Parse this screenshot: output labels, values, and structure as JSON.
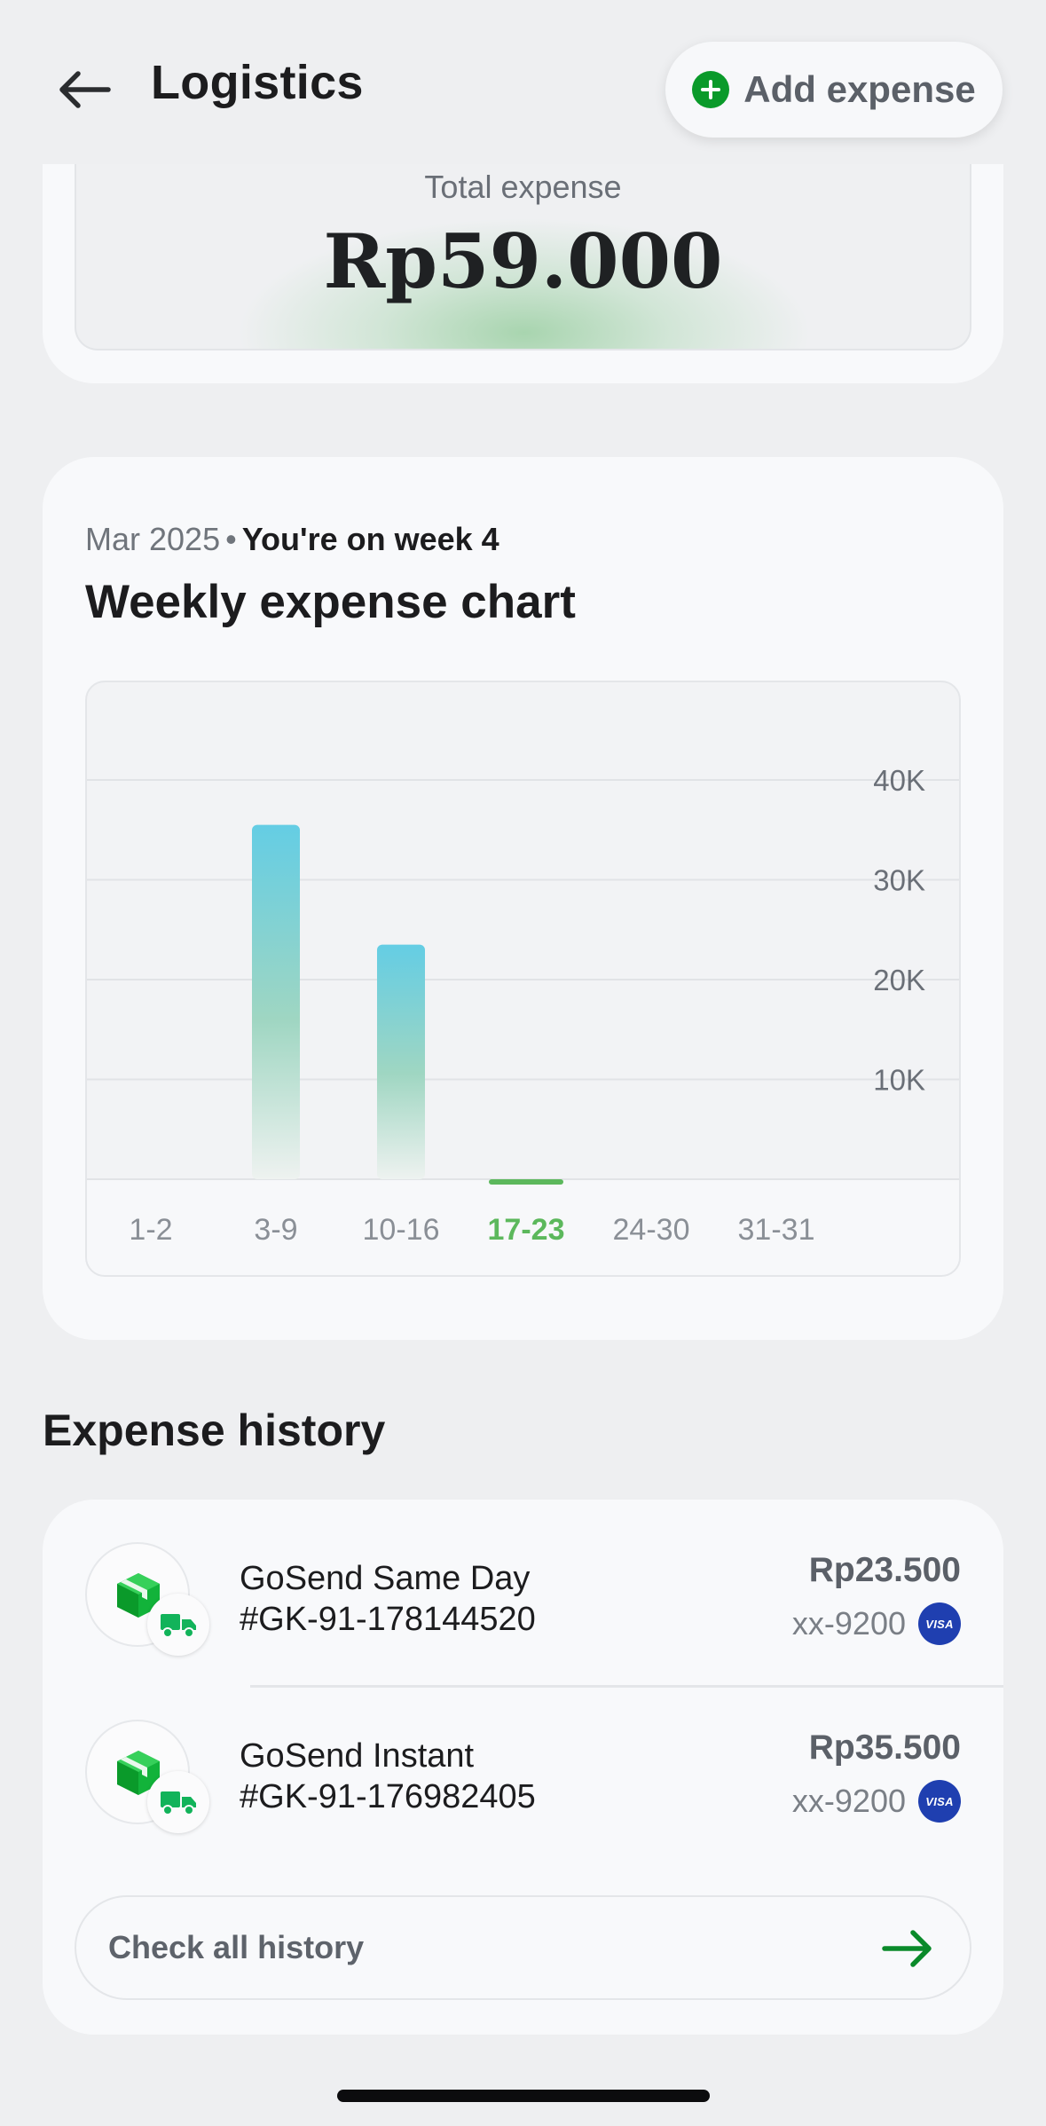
{
  "header": {
    "title": "Logistics",
    "add_button_label": "Add expense"
  },
  "total": {
    "label": "Total expense",
    "amount": "Rp59.000"
  },
  "weekly": {
    "month": "Mar 2025",
    "week_status": "You're on week 4",
    "title": "Weekly expense chart"
  },
  "chart_data": {
    "type": "bar",
    "categories": [
      "1-2",
      "3-9",
      "10-16",
      "17-23",
      "24-30",
      "31-31"
    ],
    "values": [
      0,
      35500,
      23500,
      0,
      0,
      0
    ],
    "highlighted_category": "17-23",
    "y_ticks": [
      "10K",
      "20K",
      "30K",
      "40K"
    ],
    "y_tick_values": [
      10000,
      20000,
      30000,
      40000
    ],
    "ylim": [
      0,
      40000
    ],
    "grid": true,
    "colors": {
      "bar_top": "#64cde4",
      "bar_bottom": "#eef2f0",
      "highlight": "#5cb85c",
      "grid": "#e1e3e6",
      "tick": "#6a6f77"
    }
  },
  "history": {
    "section_title": "Expense history",
    "items": [
      {
        "name": "GoSend Same Day",
        "order_id": "#GK-91-178144520",
        "amount": "Rp23.500",
        "card": "xx-9200",
        "card_brand": "VISA",
        "icon": "package-icon",
        "badge_icon": "delivery-truck-icon"
      },
      {
        "name": "GoSend Instant",
        "order_id": "#GK-91-176982405",
        "amount": "Rp35.500",
        "card": "xx-9200",
        "card_brand": "VISA",
        "icon": "package-icon",
        "badge_icon": "delivery-truck-icon"
      }
    ],
    "check_all_label": "Check all history"
  },
  "colors": {
    "brand_green": "#0a9a2a",
    "visa_blue": "#1f3fb0"
  }
}
